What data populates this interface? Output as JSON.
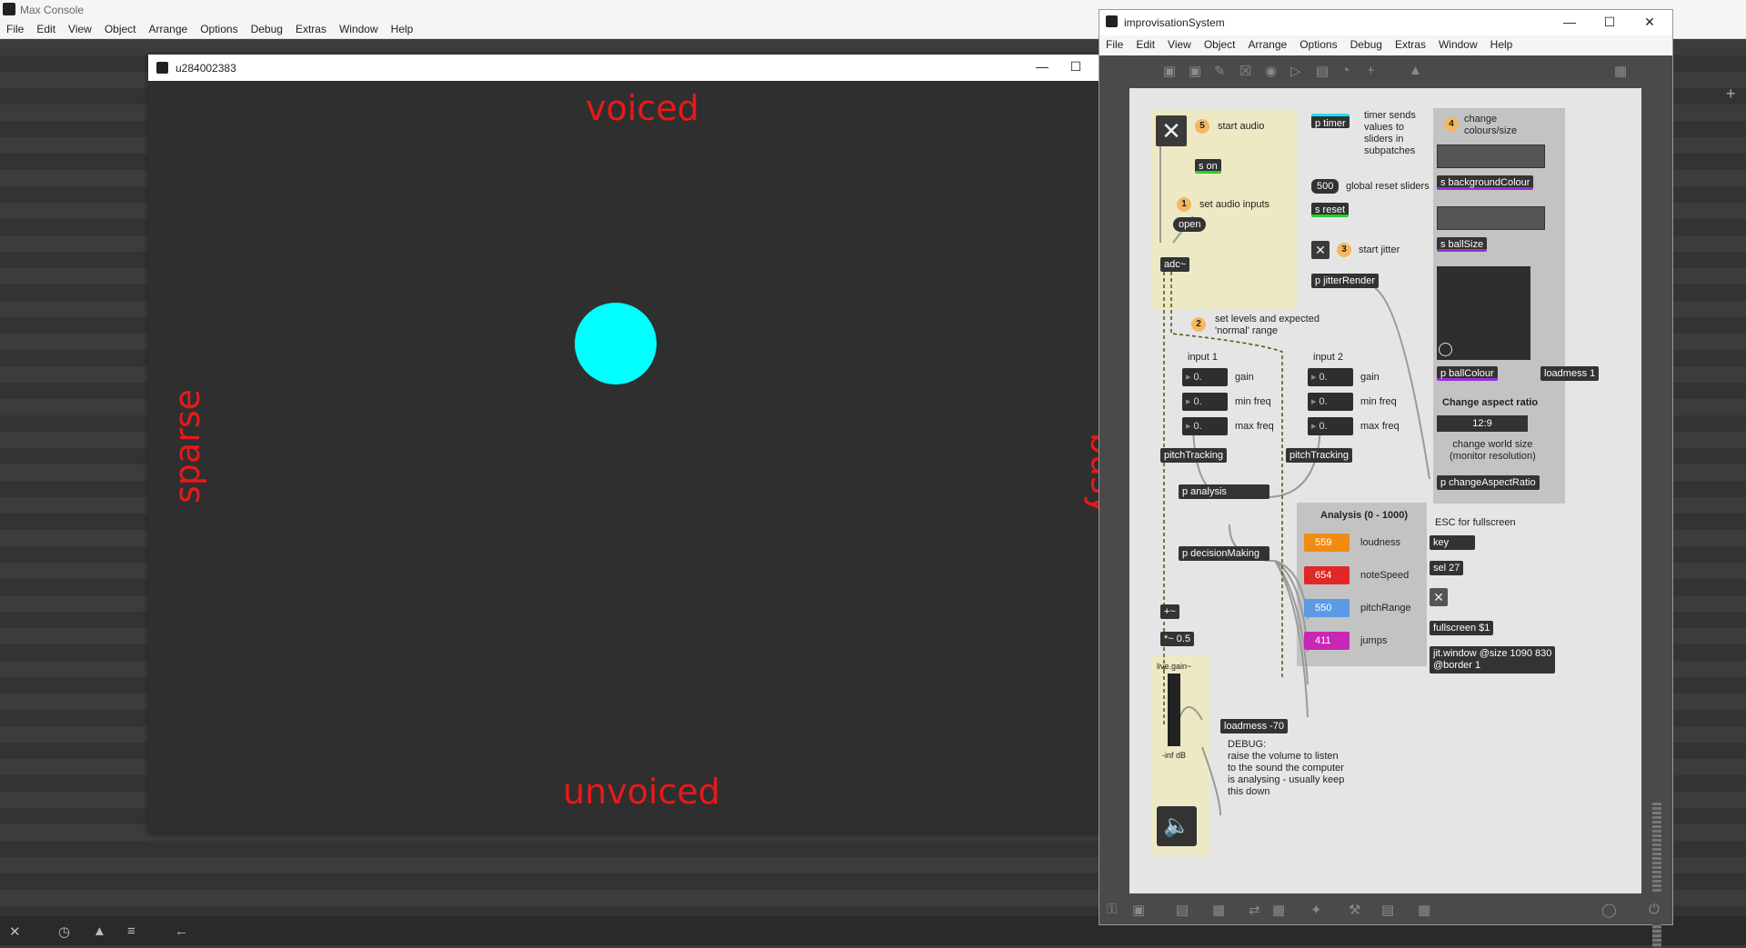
{
  "console": {
    "title": "Max Console",
    "menu": [
      "File",
      "Edit",
      "View",
      "Object",
      "Arrange",
      "Options",
      "Debug",
      "Extras",
      "Window",
      "Help"
    ]
  },
  "jitter_window": {
    "title": "u284002383",
    "labels": {
      "top": "voiced",
      "bottom": "unvoiced",
      "left": "sparse",
      "right": "busy"
    },
    "ball_color": "#00ffff",
    "text_color": "#e8191a"
  },
  "patcher": {
    "title": "improvisationSystem",
    "menu": [
      "File",
      "Edit",
      "View",
      "Object",
      "Arrange",
      "Options",
      "Debug",
      "Extras",
      "Window",
      "Help"
    ],
    "steps": {
      "s5": {
        "badge": "5",
        "text": "start audio"
      },
      "s1": {
        "badge": "1",
        "text": "set audio inputs"
      },
      "s2": {
        "badge": "2",
        "text": "set levels and expected\n'normal' range"
      },
      "s3": {
        "badge": "3",
        "text": "start jitter"
      },
      "s4": {
        "badge": "4",
        "text": "change\ncolours/size"
      }
    },
    "objects": {
      "s_on": "s on",
      "open": "open",
      "adc": "adc~",
      "p_timer": "p timer",
      "timer_desc": "timer sends\nvalues to\nsliders in\nsubpatches",
      "num_500": "500",
      "global_reset": "global reset sliders",
      "s_reset": "s reset",
      "p_jitterRender": "p jitterRender",
      "input1": "input 1",
      "input2": "input  2",
      "gain": "gain",
      "min_freq": "min freq",
      "max_freq": "max freq",
      "num_val": "0.",
      "pitchTracking": "pitchTracking",
      "p_analysis": "p analysis",
      "p_decisionMaking": "p decisionMaking",
      "plus_tilde": "+~",
      "times_tilde": "*~ 0.5",
      "live_gain": "live.gain~",
      "inf_db": "-inf dB",
      "loadmess_70": "loadmess -70",
      "debug_text": "DEBUG:\nraise the volume to listen\nto the sound the computer\nis analysing - usually keep\nthis down",
      "s_backgroundColour": "s backgroundColour",
      "s_ballSize": "s ballSize",
      "p_ballColour": "p ballColour",
      "loadmess_1": "loadmess 1",
      "change_aspect": "Change aspect ratio",
      "aspect_value": "12:9",
      "change_world": "change world size\n(monitor resolution)",
      "p_changeAspectRatio": "p changeAspectRatio",
      "esc_full": "ESC for fullscreen",
      "key": "key",
      "sel27": "sel 27",
      "fullscreen": "fullscreen $1",
      "jit_window": "jit.window @size 1090 830\n@border 1"
    },
    "analysis": {
      "title": "Analysis (0 - 1000)",
      "items": [
        {
          "value": "559",
          "label": "loudness",
          "color": "#f08c14"
        },
        {
          "value": "654",
          "label": "noteSpeed",
          "color": "#e02828"
        },
        {
          "value": "550",
          "label": "pitchRange",
          "color": "#5a9be6"
        },
        {
          "value": "411",
          "label": "jumps",
          "color": "#c828b4"
        }
      ]
    }
  }
}
